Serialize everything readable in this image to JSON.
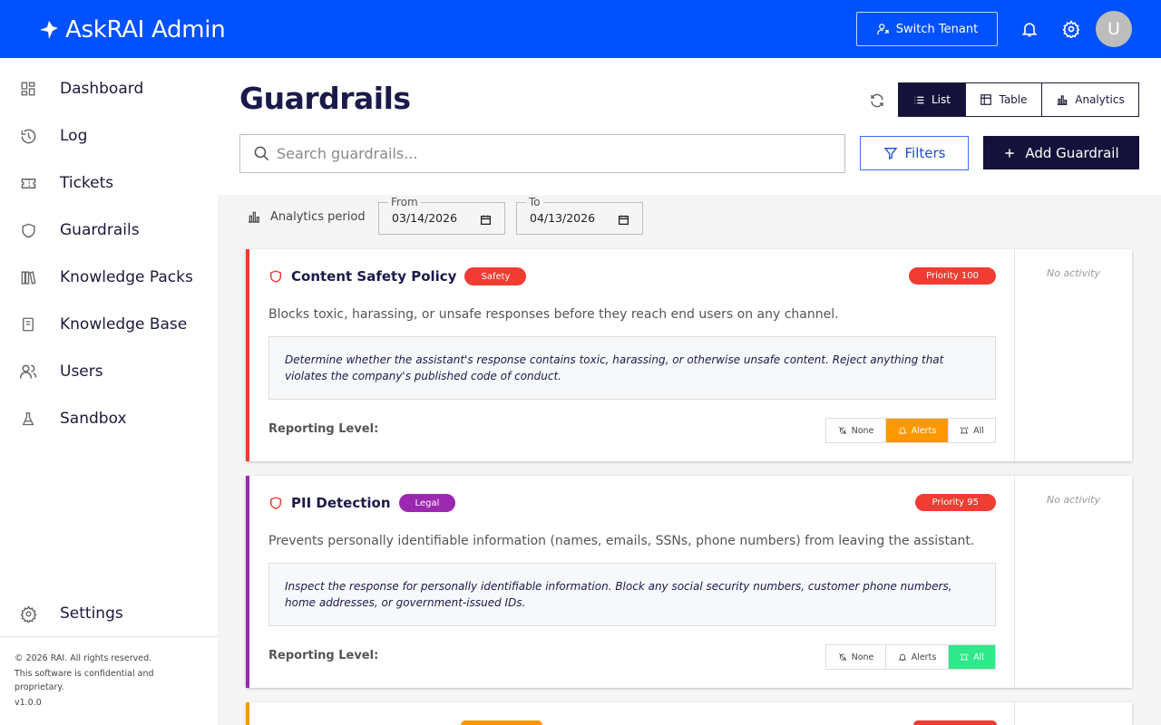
{
  "header": {
    "brand": "AskRAI Admin",
    "switch_tenant_label": "Switch Tenant",
    "avatar_initial": "U"
  },
  "sidebar": {
    "items": [
      {
        "label": "Dashboard",
        "icon": "dashboard-icon"
      },
      {
        "label": "Log",
        "icon": "history-icon"
      },
      {
        "label": "Tickets",
        "icon": "ticket-icon"
      },
      {
        "label": "Guardrails",
        "icon": "shield-icon"
      },
      {
        "label": "Knowledge Packs",
        "icon": "books-icon"
      },
      {
        "label": "Knowledge Base",
        "icon": "book-icon"
      },
      {
        "label": "Users",
        "icon": "users-icon"
      },
      {
        "label": "Sandbox",
        "icon": "flask-icon"
      }
    ],
    "settings_label": "Settings",
    "footer": {
      "copyright": "© 2026 RAI. All rights reserved.",
      "notice": "This software is confidential and proprietary.",
      "version": "v1.0.0"
    }
  },
  "page": {
    "title": "Guardrails",
    "views": [
      {
        "label": "List",
        "active": true
      },
      {
        "label": "Table",
        "active": false
      },
      {
        "label": "Analytics",
        "active": false
      }
    ],
    "search_placeholder": "Search guardrails...",
    "filters_label": "Filters",
    "add_label": "Add Guardrail"
  },
  "analytics_period": {
    "label": "Analytics period",
    "from_label": "From",
    "from_value": "03/14/2026",
    "to_label": "To",
    "to_value": "04/13/2026"
  },
  "reporting_options": [
    "None",
    "Alerts",
    "All"
  ],
  "guardrails": [
    {
      "name": "Content Safety Policy",
      "tag": "Safety",
      "tag_color": "#f03c32",
      "accent_color": "#f03c32",
      "priority": "Priority 100",
      "description": "Blocks toxic, harassing, or unsafe responses before they reach end users on any channel.",
      "prompt": "Determine whether the assistant's response contains toxic, harassing, or otherwise unsafe content. Reject anything that violates the company's published code of conduct.",
      "reporting_label": "Reporting Level:",
      "reporting_level": "Alerts",
      "activity": "No activity"
    },
    {
      "name": "PII Detection",
      "tag": "Legal",
      "tag_color": "#9c27b0",
      "accent_color": "#9c27b0",
      "priority": "Priority 95",
      "description": "Prevents personally identifiable information (names, emails, SSNs, phone numbers) from leaving the assistant.",
      "prompt": "Inspect the response for personally identifiable information. Block any social security numbers, customer phone numbers, home addresses, or government-issued IDs.",
      "reporting_label": "Reporting Level:",
      "reporting_level": "All",
      "activity": "No activity"
    }
  ],
  "colors": {
    "primary": "#0051ff",
    "navy": "#14123a",
    "alerts_on": "#ff9800",
    "all_on": "#2ee88a",
    "third_card_accent": "#ff9800"
  }
}
